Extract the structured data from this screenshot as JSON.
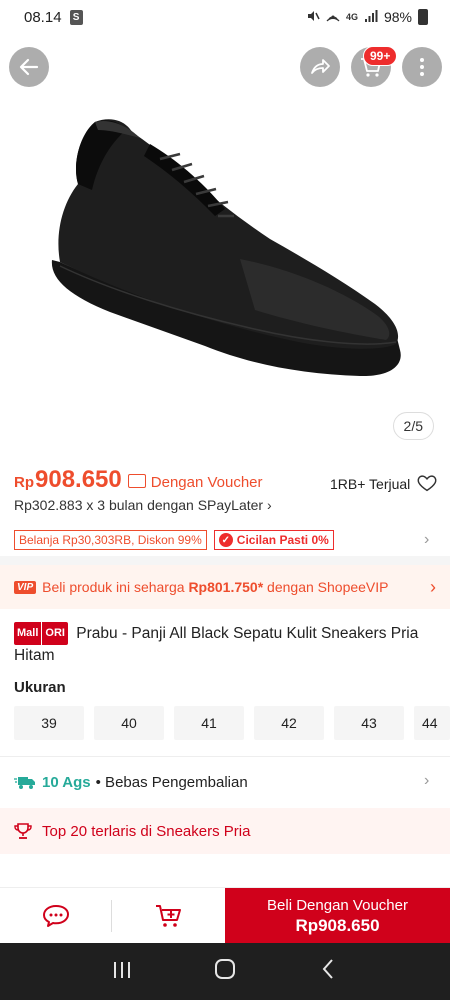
{
  "status_bar": {
    "time": "08.14",
    "app_badge": "S",
    "network": "4G",
    "battery": "98%"
  },
  "image_gallery": {
    "page_indicator": "2/5",
    "cart_badge": "99+"
  },
  "price": {
    "currency": "Rp",
    "value": "908.650",
    "voucher_label": "Dengan Voucher",
    "sold": "1RB+ Terjual",
    "installment": "Rp302.883 x 3 bulan dengan SPayLater ›"
  },
  "promos": {
    "discount_tag": "Belanja Rp30,303RB, Diskon 99%",
    "cicilan_tag": "Cicilan Pasti 0%"
  },
  "vip": {
    "badge": "VIP",
    "text_before": "Beli produk ini seharga ",
    "vip_price": "Rp801.750*",
    "text_after": " dengan ShopeeVIP"
  },
  "product": {
    "mall_label": "Mall",
    "ori_label": "ORI",
    "title": "Prabu - Panji All Black Sepatu Kulit Sneakers Pria Hitam"
  },
  "sizes": {
    "label": "Ukuran",
    "options": [
      "39",
      "40",
      "41",
      "42",
      "43",
      "44"
    ]
  },
  "shipping": {
    "date": "10 Ags",
    "separator": "• Bebas Pengembalian"
  },
  "ranking": {
    "text": "Top 20 terlaris di Sneakers Pria"
  },
  "action_bar": {
    "buy_label": "Beli Dengan Voucher",
    "buy_price": "Rp908.650"
  },
  "colors": {
    "brand": "#ee4d2d",
    "mall_red": "#d0011b",
    "shipping_green": "#26aa99"
  }
}
